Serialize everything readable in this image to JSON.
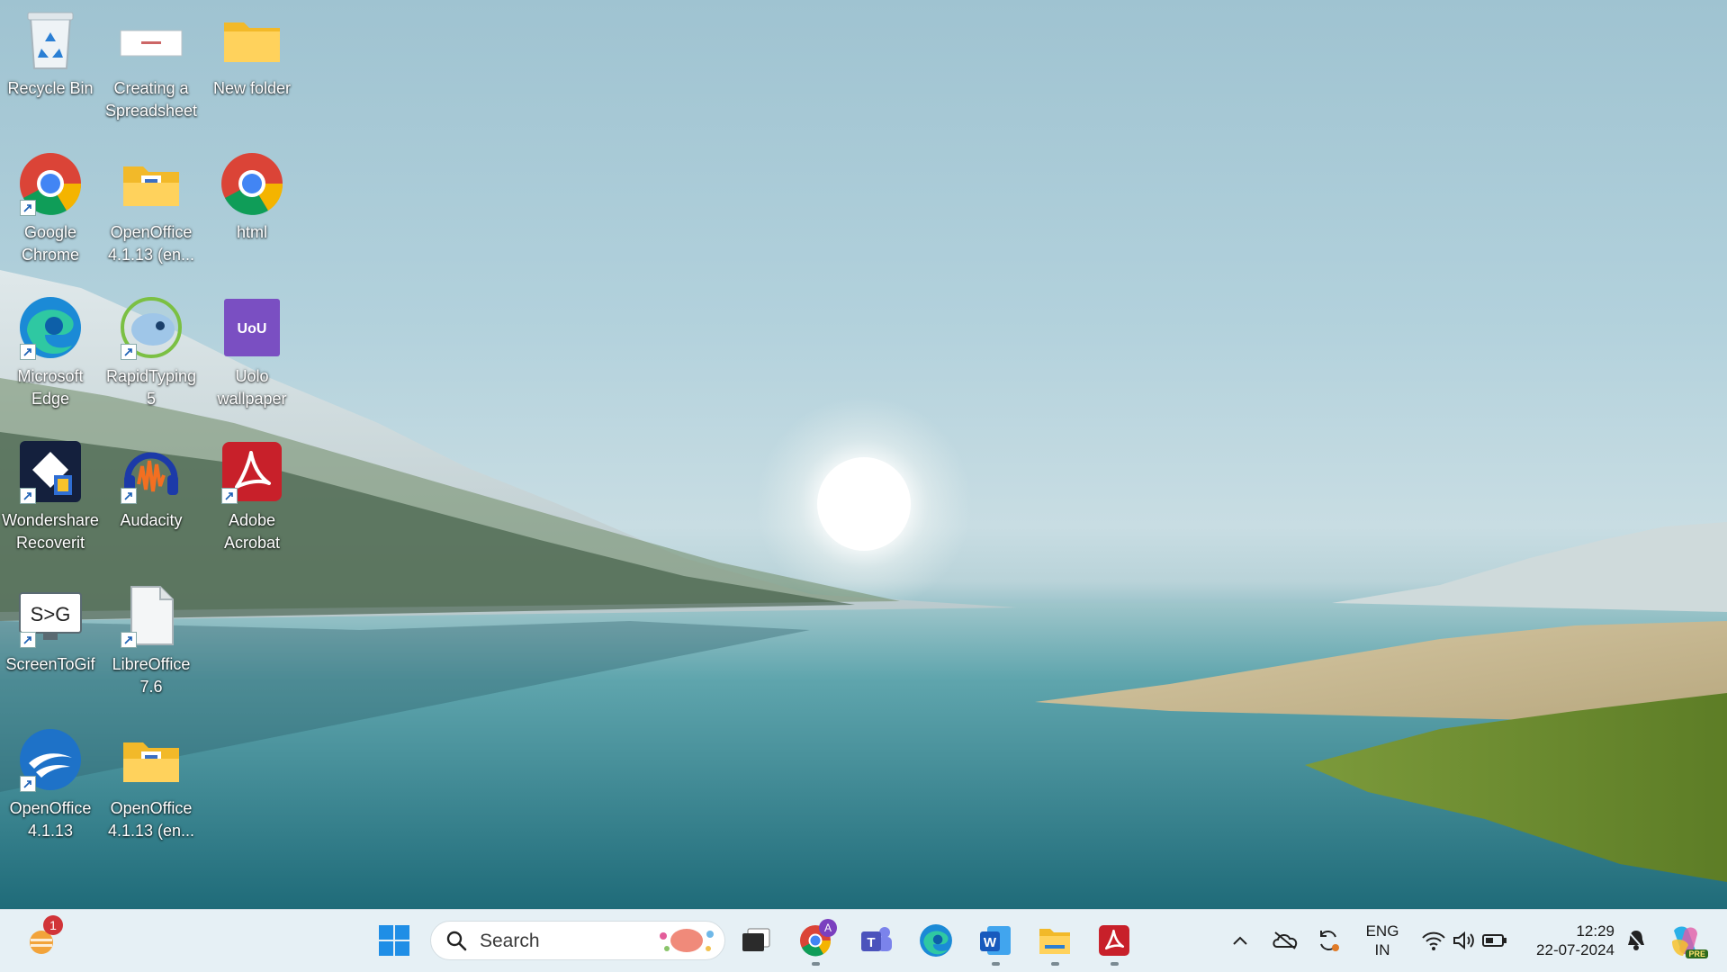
{
  "desktop": {
    "icons": [
      {
        "label": "Recycle Bin",
        "icon": "recycle-bin-icon"
      },
      {
        "label": "Creating a Spreadsheet",
        "icon": "document-thumbnail-icon"
      },
      {
        "label": "New folder",
        "icon": "folder-icon"
      },
      {
        "label": "Google Chrome",
        "icon": "chrome-icon"
      },
      {
        "label": "OpenOffice 4.1.13 (en...",
        "icon": "folder-icon"
      },
      {
        "label": "html",
        "icon": "chrome-icon"
      },
      {
        "label": "Microsoft Edge",
        "icon": "edge-icon"
      },
      {
        "label": "RapidTyping 5",
        "icon": "rapidtyping-icon"
      },
      {
        "label": "Uolo wallpaper",
        "icon": "uolo-icon"
      },
      {
        "label": "Wondershare Recoverit",
        "icon": "recoverit-icon"
      },
      {
        "label": "Audacity",
        "icon": "audacity-icon"
      },
      {
        "label": "Adobe Acrobat",
        "icon": "acrobat-icon"
      },
      {
        "label": "ScreenToGif",
        "icon": "screentogif-icon"
      },
      {
        "label": "LibreOffice 7.6",
        "icon": "libreoffice-icon"
      },
      {
        "label": "OpenOffice 4.1.13",
        "icon": "openoffice-icon"
      },
      {
        "label": "OpenOffice 4.1.13 (en...",
        "icon": "folder-icon"
      }
    ]
  },
  "taskbar": {
    "widgets_badge": "1",
    "search_placeholder": "Search",
    "chrome_profile_letter": "A",
    "teams_letter": "T",
    "word_letter": "W",
    "tray": {
      "lang_top": "ENG",
      "lang_bottom": "IN",
      "time": "12:29",
      "date": "22-07-2024",
      "copilot_badge": "PRE"
    }
  },
  "colors": {
    "accent": "#0067c0",
    "taskbar_bg": "#e6f0f5",
    "badge_red": "#d13438"
  }
}
